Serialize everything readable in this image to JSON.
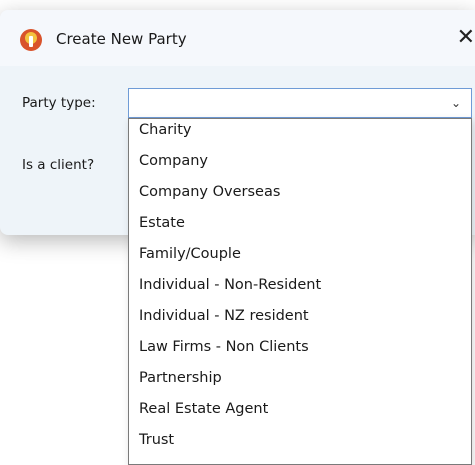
{
  "window": {
    "title": "Create New Party",
    "close_glyph": "✕",
    "app_icon": "app-logo-icon"
  },
  "form": {
    "party_type_label": "Party type:",
    "party_type_value": "",
    "is_client_label": "Is a client?"
  },
  "dropdown": {
    "chevron_glyph": "⌄",
    "options": [
      "Charity",
      "Company",
      "Company Overseas",
      "Estate",
      "Family/Couple",
      "Individual - Non-Resident",
      "Individual - NZ resident",
      "Law Firms - Non Clients",
      "Partnership",
      "Real Estate Agent",
      "Trust"
    ]
  },
  "colors": {
    "dialog_background": "#eef4f9",
    "select_border": "#6f9bd6",
    "app_icon_primary": "#d9532b",
    "app_icon_secondary": "#f3c23f"
  }
}
